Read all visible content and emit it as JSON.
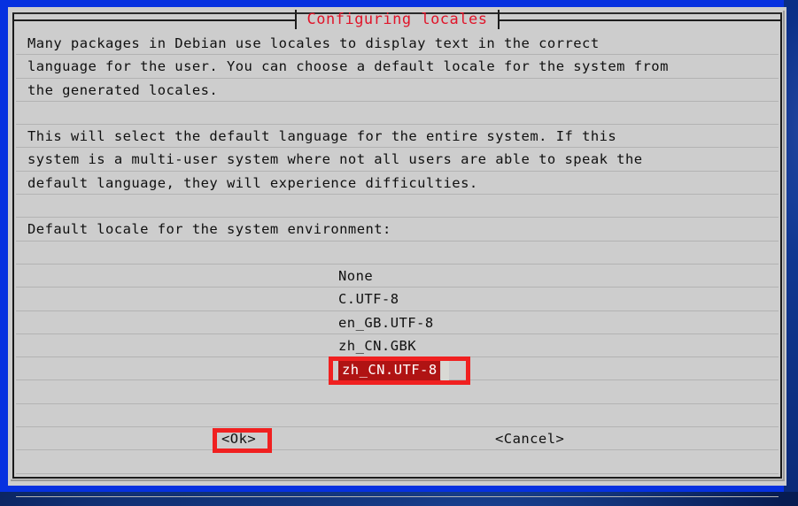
{
  "window": {
    "title": "Configuring locales",
    "title_color": "#e0152a",
    "background_color": "#cdcdcd",
    "desktop_color": "#0631e0"
  },
  "body_paragraphs": [
    "Many packages in Debian use locales to display text in the correct",
    "language for the user. You can choose a default locale for the system from",
    "the generated locales.",
    "",
    "This will select the default language for the entire system. If this",
    "system is a multi-user system where not all users are able to speak the",
    "default language, they will experience difficulties."
  ],
  "prompt": "Default locale for the system environment:",
  "locale_list": {
    "items": [
      {
        "label": "None",
        "selected": false
      },
      {
        "label": "C.UTF-8",
        "selected": false
      },
      {
        "label": "en_GB.UTF-8",
        "selected": false
      },
      {
        "label": "zh_CN.GBK",
        "selected": false
      },
      {
        "label": "zh_CN.UTF-8",
        "selected": true
      }
    ],
    "selected_value": "zh_CN.UTF-8",
    "highlight_color": "#b01313",
    "highlight_text_color": "#ffffff"
  },
  "buttons": {
    "ok": "<Ok>",
    "cancel": "<Cancel>"
  },
  "annotations": {
    "color": "#f02020",
    "targets": [
      "zh_CN.UTF-8",
      "<Ok>"
    ]
  }
}
